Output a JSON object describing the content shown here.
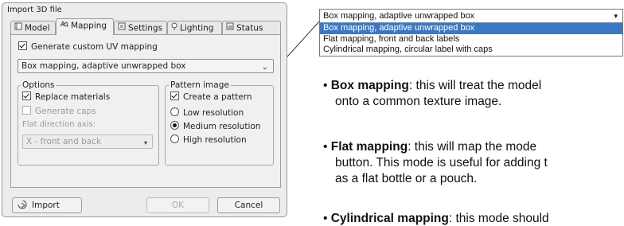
{
  "dialog": {
    "title": "Import 3D file",
    "tabs": [
      {
        "label": "Model",
        "icon": "model-icon"
      },
      {
        "label": "Mapping",
        "icon": "mapping-icon"
      },
      {
        "label": "Settings",
        "icon": "settings-icon"
      },
      {
        "label": "Lighting",
        "icon": "lighting-icon"
      },
      {
        "label": "Status",
        "icon": "status-icon"
      }
    ],
    "active_tab": "Mapping",
    "generate_uv": {
      "label": "Generate custom UV mapping",
      "checked": true
    },
    "mapping_combo": {
      "value": "Box mapping, adaptive unwrapped box"
    },
    "options": {
      "legend": "Options",
      "replace_materials": {
        "label": "Replace materials",
        "checked": true
      },
      "generate_caps": {
        "label": "Generate caps",
        "checked": false,
        "disabled": true
      },
      "flat_axis_label": "Flat direction axis:",
      "flat_axis_value": "X - front and back"
    },
    "pattern": {
      "legend": "Pattern image",
      "create_pattern": {
        "label": "Create a pattern",
        "checked": true
      },
      "resolutions": [
        {
          "label": "Low resolution",
          "selected": false
        },
        {
          "label": "Medium resolution",
          "selected": true
        },
        {
          "label": "High resolution",
          "selected": false
        }
      ]
    },
    "buttons": {
      "import": "Import",
      "ok": "OK",
      "cancel": "Cancel"
    }
  },
  "dropdown": {
    "current": "Box mapping, adaptive unwrapped box",
    "options": [
      {
        "label": "Box mapping, adaptive unwrapped box",
        "selected": true
      },
      {
        "label": "Flat mapping, front and back labels",
        "selected": false
      },
      {
        "label": "Cylindrical mapping, circular label with caps",
        "selected": false
      }
    ]
  },
  "descriptions": [
    {
      "term": "Box mapping",
      "line1": ": this will treat the model",
      "line2": "onto a common texture image."
    },
    {
      "term": "Flat mapping",
      "line1": ": this will map the mode",
      "line2": "button. This mode is useful for adding t",
      "line3": "as a flat bottle or a pouch."
    },
    {
      "term": "Cylindrical mapping",
      "line1": ": this mode should"
    }
  ],
  "colors": {
    "selection": "#3a78c2"
  }
}
